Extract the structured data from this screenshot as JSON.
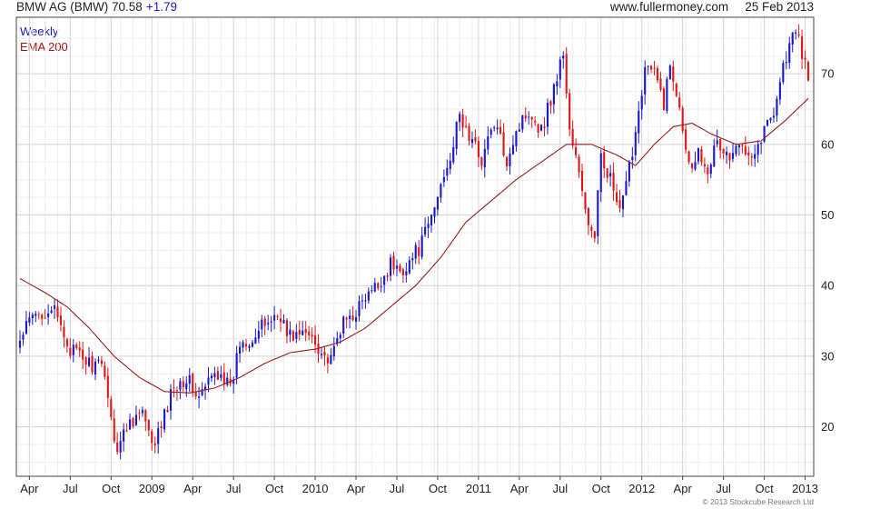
{
  "header": {
    "title": "BMW AG (BMW)",
    "last": "70.58",
    "change": "+1.79",
    "source": "www.fullermoney.com",
    "date": "25 Feb 2013"
  },
  "legend": {
    "weekly": "Weekly",
    "ema": "EMA 200"
  },
  "copyright": "© 2013 Stockcube Research Ltd",
  "colors": {
    "up": "#1a1acc",
    "down": "#e01818",
    "ema": "#9b1b1b",
    "grid": "#d6d6d6",
    "frame": "#444444"
  },
  "chart_data": {
    "type": "candlestick",
    "ylim": [
      13,
      78
    ],
    "yticks": [
      20,
      30,
      40,
      50,
      60,
      70
    ],
    "x_tick_labels": [
      "Apr",
      "Jul",
      "Oct",
      "2009",
      "Apr",
      "Jul",
      "Oct",
      "2010",
      "Apr",
      "Jul",
      "Oct",
      "2011",
      "Apr",
      "Jul",
      "Oct",
      "2012",
      "Apr",
      "Jul",
      "Oct",
      "2013"
    ],
    "x_tick_weeks": [
      3,
      16,
      29,
      42,
      55,
      68,
      81,
      94,
      107,
      120,
      133,
      146,
      159,
      172,
      185,
      198,
      211,
      224,
      237,
      250
    ],
    "total_weeks": 252,
    "close_anchors": [
      [
        0,
        32
      ],
      [
        3,
        35
      ],
      [
        10,
        37
      ],
      [
        16,
        31
      ],
      [
        22,
        29
      ],
      [
        27,
        28
      ],
      [
        29,
        21
      ],
      [
        31,
        17
      ],
      [
        35,
        21
      ],
      [
        39,
        22
      ],
      [
        42,
        17
      ],
      [
        45,
        20
      ],
      [
        49,
        26
      ],
      [
        53,
        27
      ],
      [
        57,
        24
      ],
      [
        61,
        27
      ],
      [
        64,
        28
      ],
      [
        67,
        25
      ],
      [
        70,
        32
      ],
      [
        75,
        33
      ],
      [
        79,
        35
      ],
      [
        83,
        36
      ],
      [
        85,
        33
      ],
      [
        89,
        33
      ],
      [
        93,
        33
      ],
      [
        97,
        30
      ],
      [
        99,
        29
      ],
      [
        102,
        34
      ],
      [
        106,
        36
      ],
      [
        110,
        38
      ],
      [
        114,
        40
      ],
      [
        118,
        43
      ],
      [
        121,
        42
      ],
      [
        125,
        44
      ],
      [
        128,
        46
      ],
      [
        132,
        51
      ],
      [
        135,
        56
      ],
      [
        138,
        60
      ],
      [
        140,
        64
      ],
      [
        143,
        61
      ],
      [
        147,
        58
      ],
      [
        151,
        63
      ],
      [
        155,
        58
      ],
      [
        158,
        62
      ],
      [
        162,
        65
      ],
      [
        166,
        62
      ],
      [
        170,
        68
      ],
      [
        173,
        73
      ],
      [
        175,
        62
      ],
      [
        177,
        58
      ],
      [
        179,
        53
      ],
      [
        181,
        49
      ],
      [
        183,
        46
      ],
      [
        185,
        59
      ],
      [
        188,
        55
      ],
      [
        191,
        50
      ],
      [
        193,
        54
      ],
      [
        196,
        62
      ],
      [
        199,
        71
      ],
      [
        202,
        70
      ],
      [
        205,
        66
      ],
      [
        207,
        71
      ],
      [
        210,
        66
      ],
      [
        213,
        57
      ],
      [
        216,
        59
      ],
      [
        219,
        57
      ],
      [
        222,
        60
      ],
      [
        226,
        58
      ],
      [
        230,
        60
      ],
      [
        234,
        59
      ],
      [
        237,
        62
      ],
      [
        240,
        65
      ],
      [
        243,
        71
      ],
      [
        245,
        74
      ],
      [
        247,
        76
      ],
      [
        249,
        73
      ],
      [
        251,
        70
      ]
    ],
    "ema_anchors": [
      [
        0,
        41
      ],
      [
        8,
        39
      ],
      [
        15,
        37
      ],
      [
        22,
        34
      ],
      [
        30,
        30
      ],
      [
        38,
        27
      ],
      [
        46,
        25
      ],
      [
        54,
        24.8
      ],
      [
        62,
        25.5
      ],
      [
        70,
        27
      ],
      [
        78,
        29
      ],
      [
        86,
        30.5
      ],
      [
        94,
        31
      ],
      [
        102,
        32
      ],
      [
        110,
        34
      ],
      [
        118,
        37
      ],
      [
        126,
        40
      ],
      [
        134,
        44
      ],
      [
        142,
        49
      ],
      [
        150,
        52
      ],
      [
        158,
        55
      ],
      [
        166,
        57.5
      ],
      [
        174,
        60
      ],
      [
        182,
        60
      ],
      [
        190,
        58.5
      ],
      [
        196,
        57
      ],
      [
        202,
        60
      ],
      [
        208,
        62.5
      ],
      [
        214,
        63
      ],
      [
        220,
        61.5
      ],
      [
        228,
        60
      ],
      [
        236,
        60.5
      ],
      [
        244,
        63.5
      ],
      [
        251,
        66.5
      ]
    ]
  }
}
